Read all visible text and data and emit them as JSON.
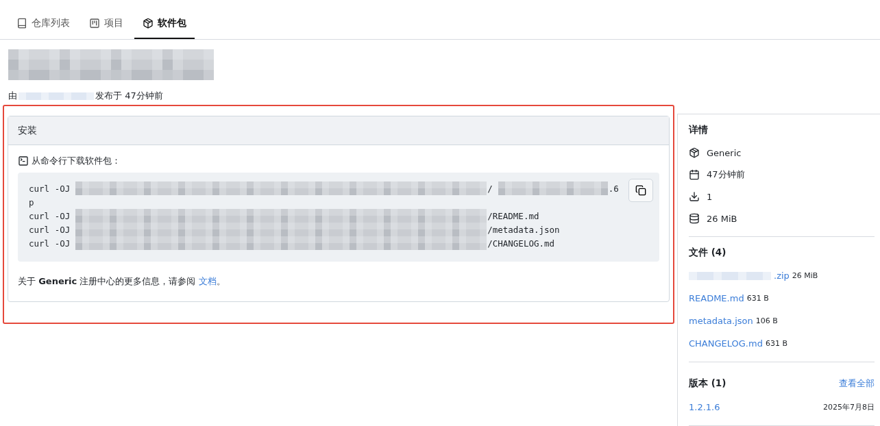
{
  "tabs": [
    {
      "label": "仓库列表",
      "selected": false
    },
    {
      "label": "项目",
      "selected": false
    },
    {
      "label": "软件包",
      "selected": true
    }
  ],
  "header": {
    "title": {
      "kind": "redacted"
    },
    "byline": [
      {
        "kind": "text",
        "text": "由"
      },
      {
        "kind": "redacted"
      },
      {
        "kind": "text",
        "text": "发布于 47分钟前"
      }
    ]
  },
  "install": {
    "title": "安装",
    "subtitle": "从命令行下载软件包：",
    "commands": [
      {
        "segments": [
          {
            "kind": "text",
            "text": "curl -OJ"
          },
          {
            "kind": "redacted"
          },
          {
            "kind": "text",
            "text": "/"
          },
          {
            "kind": "redacted"
          },
          {
            "kind": "text",
            "text": ".6"
          }
        ],
        "continuation": "p"
      },
      {
        "segments": [
          {
            "kind": "text",
            "text": "curl -OJ"
          },
          {
            "kind": "redacted"
          },
          {
            "kind": "text",
            "text": "/README.md"
          }
        ]
      },
      {
        "segments": [
          {
            "kind": "text",
            "text": "curl -OJ"
          },
          {
            "kind": "redacted"
          },
          {
            "kind": "text",
            "text": "/metadata.json"
          }
        ]
      },
      {
        "segments": [
          {
            "kind": "text",
            "text": "curl -OJ"
          },
          {
            "kind": "redacted"
          },
          {
            "kind": "text",
            "text": "/CHANGELOG.md"
          }
        ]
      }
    ],
    "note": "关于 **Generic** 注册中心的更多信息，请参阅",
    "note_link": "文档",
    "note_end": "。"
  },
  "details": {
    "title": "详情",
    "items": [
      {
        "text": "Generic"
      },
      {
        "text": "47分钟前"
      },
      {
        "text": "1"
      },
      {
        "text": "26 MiB"
      }
    ]
  },
  "files": {
    "title": "文件 (4)",
    "items": [
      {
        "name": [
          {
            "kind": "redacted"
          },
          {
            "kind": "text",
            "text": ".zip"
          }
        ],
        "size": "26 MiB"
      },
      {
        "name": [
          {
            "kind": "text",
            "text": "README.md"
          }
        ],
        "size": "631 B"
      },
      {
        "name": [
          {
            "kind": "text",
            "text": "metadata.json"
          }
        ],
        "size": "106 B"
      },
      {
        "name": [
          {
            "kind": "text",
            "text": "CHANGELOG.md"
          }
        ],
        "size": "631 B"
      }
    ]
  },
  "versions": {
    "title": "版本 (1)",
    "view_all": "查看全部",
    "items": [
      {
        "version": "1.2.1.6",
        "date": "2025年7月8日"
      }
    ]
  }
}
